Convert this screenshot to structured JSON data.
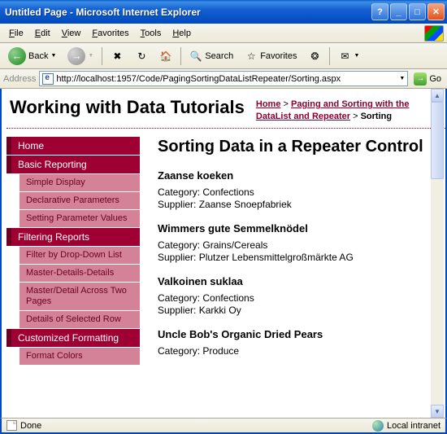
{
  "window": {
    "title": "Untitled Page - Microsoft Internet Explorer"
  },
  "menubar": {
    "file": "File",
    "edit": "Edit",
    "view": "View",
    "favorites": "Favorites",
    "tools": "Tools",
    "help": "Help"
  },
  "toolbar": {
    "back": "Back",
    "search": "Search",
    "favorites": "Favorites"
  },
  "addressbar": {
    "label": "Address",
    "url": "http://localhost:1957/Code/PagingSortingDataListRepeater/Sorting.aspx",
    "go": "Go"
  },
  "page": {
    "title": "Working with Data Tutorials",
    "breadcrumb": {
      "home": "Home",
      "section": "Paging and Sorting with the DataList and Repeater",
      "current": "Sorting",
      "sep": ">"
    }
  },
  "sidebar": {
    "cat_home": "Home",
    "cat_basic": "Basic Reporting",
    "basic_items": {
      "0": "Simple Display",
      "1": "Declarative Parameters",
      "2": "Setting Parameter Values"
    },
    "cat_filtering": "Filtering Reports",
    "filtering_items": {
      "0": "Filter by Drop-Down List",
      "1": "Master-Details-Details",
      "2": "Master/Detail Across Two Pages",
      "3": "Details of Selected Row"
    },
    "cat_custom": "Customized Formatting",
    "custom_items": {
      "0": "Format Colors"
    }
  },
  "main": {
    "heading": "Sorting Data in a Repeater Control",
    "products": {
      "0": {
        "name": "Zaanse koeken",
        "category": "Category: Confections",
        "supplier": "Supplier: Zaanse Snoepfabriek"
      },
      "1": {
        "name": "Wimmers gute Semmelknödel",
        "category": "Category: Grains/Cereals",
        "supplier": "Supplier: Plutzer Lebensmittelgroßmärkte AG"
      },
      "2": {
        "name": "Valkoinen suklaa",
        "category": "Category: Confections",
        "supplier": "Supplier: Karkki Oy"
      },
      "3": {
        "name": "Uncle Bob's Organic Dried Pears",
        "category": "Category: Produce",
        "supplier": ""
      }
    }
  },
  "statusbar": {
    "done": "Done",
    "zone": "Local intranet"
  }
}
